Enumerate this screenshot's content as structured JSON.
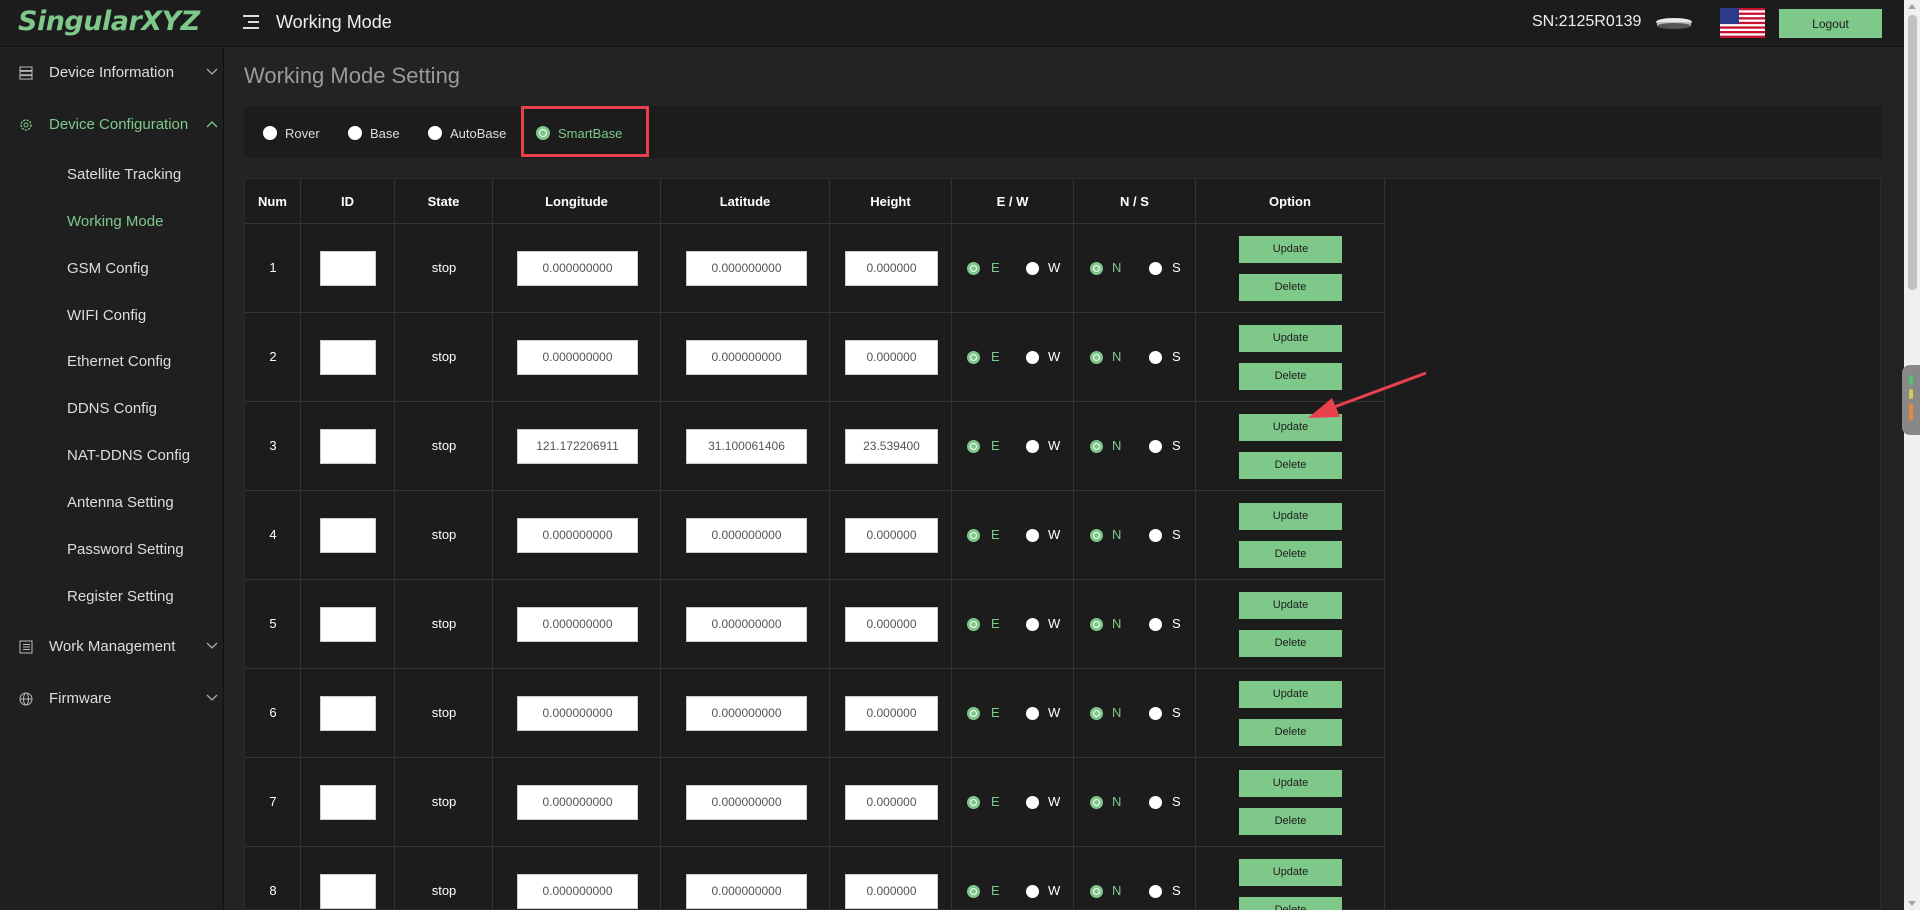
{
  "header": {
    "logo": "SingularXYZ",
    "title": "Working Mode",
    "serial": "SN:2125R0139",
    "logout_label": "Logout"
  },
  "sidebar": {
    "items": [
      {
        "label": "Device Information",
        "icon": "server-icon"
      },
      {
        "label": "Device Configuration",
        "icon": "gear-icon"
      },
      {
        "label": "Work Management",
        "icon": "list-icon"
      },
      {
        "label": "Firmware",
        "icon": "globe-icon"
      }
    ],
    "sub_items": [
      {
        "label": "Satellite Tracking"
      },
      {
        "label": "Working Mode"
      },
      {
        "label": "GSM Config"
      },
      {
        "label": "WIFI Config"
      },
      {
        "label": "Ethernet Config"
      },
      {
        "label": "DDNS Config"
      },
      {
        "label": "NAT-DDNS Config"
      },
      {
        "label": "Antenna Setting"
      },
      {
        "label": "Password Setting"
      },
      {
        "label": "Register Setting"
      }
    ]
  },
  "main": {
    "section_title": "Working Mode Setting",
    "modes": [
      {
        "label": "Rover",
        "selected": false
      },
      {
        "label": "Base",
        "selected": false
      },
      {
        "label": "AutoBase",
        "selected": false
      },
      {
        "label": "SmartBase",
        "selected": true
      }
    ],
    "table": {
      "headers": [
        "Num",
        "ID",
        "State",
        "Longitude",
        "Latitude",
        "Height",
        "E / W",
        "N / S",
        "Option"
      ],
      "ew_labels": [
        "E",
        "W"
      ],
      "ns_labels": [
        "N",
        "S"
      ],
      "update_label": "Update",
      "delete_label": "Delete",
      "rows": [
        {
          "num": "1",
          "id": "",
          "state": "stop",
          "lon": "0.000000000",
          "lat": "0.000000000",
          "height": "0.000000",
          "ew": "E",
          "ns": "N"
        },
        {
          "num": "2",
          "id": "",
          "state": "stop",
          "lon": "0.000000000",
          "lat": "0.000000000",
          "height": "0.000000",
          "ew": "E",
          "ns": "N"
        },
        {
          "num": "3",
          "id": "",
          "state": "stop",
          "lon": "121.172206911",
          "lat": "31.100061406",
          "height": "23.539400",
          "ew": "E",
          "ns": "N"
        },
        {
          "num": "4",
          "id": "",
          "state": "stop",
          "lon": "0.000000000",
          "lat": "0.000000000",
          "height": "0.000000",
          "ew": "E",
          "ns": "N"
        },
        {
          "num": "5",
          "id": "",
          "state": "stop",
          "lon": "0.000000000",
          "lat": "0.000000000",
          "height": "0.000000",
          "ew": "E",
          "ns": "N"
        },
        {
          "num": "6",
          "id": "",
          "state": "stop",
          "lon": "0.000000000",
          "lat": "0.000000000",
          "height": "0.000000",
          "ew": "E",
          "ns": "N"
        },
        {
          "num": "7",
          "id": "",
          "state": "stop",
          "lon": "0.000000000",
          "lat": "0.000000000",
          "height": "0.000000",
          "ew": "E",
          "ns": "N"
        },
        {
          "num": "8",
          "id": "",
          "state": "stop",
          "lon": "0.000000000",
          "lat": "0.000000000",
          "height": "0.000000",
          "ew": "E",
          "ns": "N"
        }
      ]
    }
  },
  "colors": {
    "accent": "#7ec98a",
    "highlight": "#e8414d",
    "background": "#232323"
  }
}
